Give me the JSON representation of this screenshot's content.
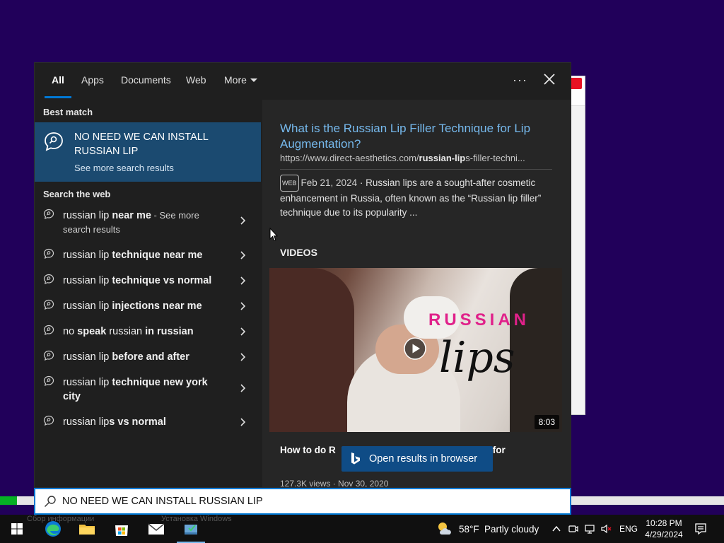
{
  "tabs": [
    {
      "label": "All"
    },
    {
      "label": "Apps"
    },
    {
      "label": "Documents"
    },
    {
      "label": "Web"
    },
    {
      "label": "More"
    }
  ],
  "best_match": {
    "section_title": "Best match",
    "title": "NO NEED WE CAN INSTALL RUSSIAN LIP",
    "subtitle": "See more search results"
  },
  "search_web": {
    "section_title": "Search the web",
    "suggestions": [
      {
        "normal": "russian lip ",
        "bold": "near me",
        "suffix": " - See more search results"
      },
      {
        "normal": "russian lip ",
        "bold": "technique near me",
        "suffix": ""
      },
      {
        "normal": "russian lip ",
        "bold": "technique vs normal",
        "suffix": ""
      },
      {
        "normal": "russian lip ",
        "bold": "injections near me",
        "suffix": ""
      },
      {
        "normal": "no ",
        "bold": "speak",
        "mid": " russian ",
        "bold2": "in russian",
        "suffix": ""
      },
      {
        "normal": "russian lip ",
        "bold": "before and after",
        "suffix": ""
      },
      {
        "normal": "russian lip ",
        "bold": "technique new york city",
        "suffix": ""
      },
      {
        "normal": "russian lip",
        "bold": "s vs normal",
        "suffix": ""
      }
    ]
  },
  "result": {
    "title": "What is the Russian Lip Filler Technique for Lip Augmentation?",
    "url_prefix": "https://www.direct-aesthetics.com/",
    "url_bold": "russian-lip",
    "url_suffix": "s-filler-techni...",
    "badge": "WEB",
    "date": "Feb 21, 2024",
    "snippet": " · Russian lips are a sought-after cosmetic enhancement in Russia, often known as the “Russian lip filler” technique due to its popularity ..."
  },
  "videos": {
    "label": "VIDEOS",
    "overlay_line1": "RUSSIAN",
    "overlay_line2": "lips",
    "duration": "8:03",
    "title": "How to do R",
    "title_end": "for",
    "meta": "127.3K views · Nov 30, 2020"
  },
  "open_browser": {
    "label": "Open results in browser"
  },
  "search_box": {
    "value": "NO NEED WE CAN INSTALL RUSSIAN LIP"
  },
  "taskbar": {
    "weather_temp": "58°F",
    "weather_condition": "Partly cloudy",
    "language": "ENG",
    "time": "10:28 PM",
    "date": "4/29/2024",
    "ghost_text_1": "Сбор информации",
    "ghost_text_2": "Установка Windows"
  },
  "colors": {
    "desktop": "#21005a",
    "accent": "#0078d4",
    "link": "#76b9ed",
    "best_match_bg": "#1b4a70"
  }
}
